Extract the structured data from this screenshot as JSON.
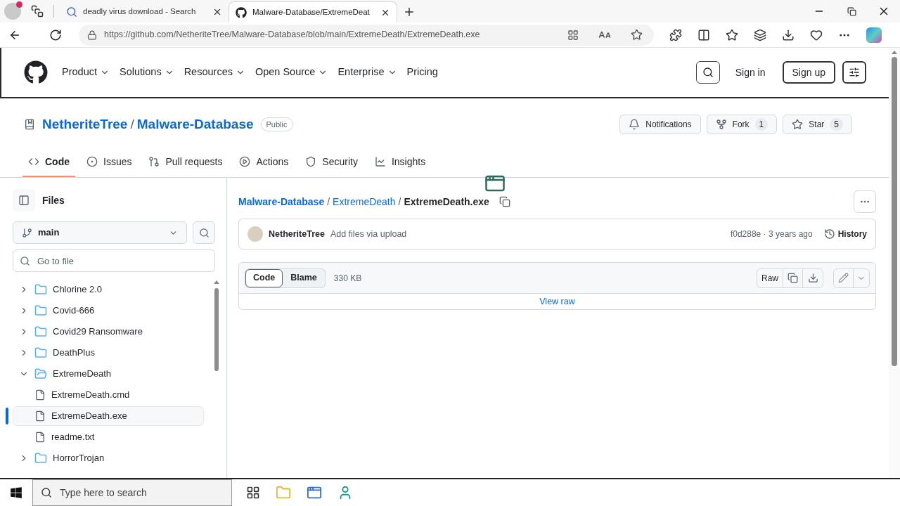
{
  "browser": {
    "tabs": [
      {
        "kind": "search",
        "title": "deadly virus download - Search",
        "selected": false
      },
      {
        "kind": "github",
        "title": "Malware-Database/ExtremeDeat",
        "selected": true
      }
    ],
    "url": "https://github.com/NetheriteTree/Malware-Database/blob/main/ExtremeDeath/ExtremeDeath.exe"
  },
  "header": {
    "nav": [
      {
        "label": "Product",
        "has_menu": true
      },
      {
        "label": "Solutions",
        "has_menu": true
      },
      {
        "label": "Resources",
        "has_menu": true
      },
      {
        "label": "Open Source",
        "has_menu": true
      },
      {
        "label": "Enterprise",
        "has_menu": true
      },
      {
        "label": "Pricing",
        "has_menu": false
      }
    ],
    "sign_in": "Sign in",
    "sign_up": "Sign up"
  },
  "repo": {
    "owner": "NetheriteTree",
    "separator": "/",
    "name": "Malware-Database",
    "visibility": "Public",
    "buttons": [
      {
        "kind": "notifications",
        "label": "Notifications"
      },
      {
        "kind": "fork",
        "label": "Fork",
        "count": "1"
      },
      {
        "kind": "star",
        "label": "Star",
        "count": "5"
      }
    ],
    "tabs": [
      {
        "kind": "code",
        "label": "Code",
        "selected": true
      },
      {
        "kind": "issues",
        "label": "Issues",
        "selected": false
      },
      {
        "kind": "pulls",
        "label": "Pull requests",
        "selected": false
      },
      {
        "kind": "actions",
        "label": "Actions",
        "selected": false
      },
      {
        "kind": "security",
        "label": "Security",
        "selected": false
      },
      {
        "kind": "insights",
        "label": "Insights",
        "selected": false
      }
    ]
  },
  "sidebar": {
    "title": "Files",
    "branch": "main",
    "search_placeholder": "Go to file",
    "tree": [
      {
        "kind": "folder",
        "name": "Chlorine 2.0",
        "expanded": false,
        "selected": false
      },
      {
        "kind": "folder",
        "name": "Covid-666",
        "expanded": false,
        "selected": false
      },
      {
        "kind": "folder",
        "name": "Covid29 Ransomware",
        "expanded": false,
        "selected": false
      },
      {
        "kind": "folder",
        "name": "DeathPlus",
        "expanded": false,
        "selected": false
      },
      {
        "kind": "folder",
        "name": "ExtremeDeath",
        "expanded": true,
        "selected": false,
        "children": [
          {
            "kind": "file",
            "name": "ExtremeDeath.cmd",
            "selected": false
          },
          {
            "kind": "file",
            "name": "ExtremeDeath.exe",
            "selected": true
          },
          {
            "kind": "file",
            "name": "readme.txt",
            "selected": false
          }
        ]
      },
      {
        "kind": "folder",
        "name": "HorrorTrojan",
        "expanded": false,
        "selected": false
      }
    ]
  },
  "file": {
    "breadcrumb": [
      {
        "kind": "link",
        "text": "Malware-Database"
      },
      {
        "kind": "separator",
        "text": "/"
      },
      {
        "kind": "link",
        "text": "ExtremeDeath"
      },
      {
        "kind": "separator",
        "text": "/"
      },
      {
        "kind": "current",
        "text": "ExtremeDeath.exe"
      }
    ],
    "commit": {
      "author": "NetheriteTree",
      "message": "Add files via upload",
      "hash_time": "f0d288e · 3 years ago",
      "history": "History"
    },
    "view_tabs": [
      {
        "label": "Code",
        "selected": true
      },
      {
        "label": "Blame",
        "selected": false
      }
    ],
    "size": "330 KB",
    "raw": "Raw",
    "view_raw": "View raw"
  },
  "taskbar": {
    "search_placeholder": "Type here to search"
  }
}
